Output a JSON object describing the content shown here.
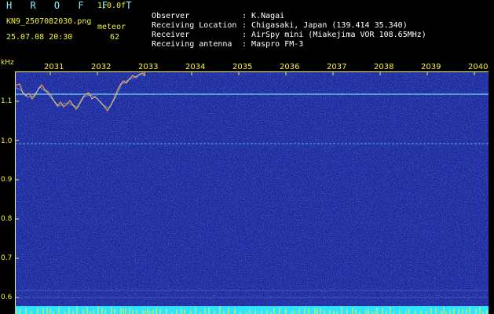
{
  "header": {
    "title": "H R O F F T",
    "version": "1.0.0f",
    "filename": "KN9_2507082030.png",
    "meteor_label": "meteor",
    "datetime": "25.07.08 20:30",
    "meteor_count": "62"
  },
  "meta": [
    {
      "key": "Observer",
      "sep": ":",
      "value": "K.Nagai"
    },
    {
      "key": "Receiving Location",
      "sep": ":",
      "value": "Chigasaki, Japan (139.414 35.340)"
    },
    {
      "key": "Receiver",
      "sep": ":",
      "value": "AirSpy mini (Miakejima VOR 108.65MHz)"
    },
    {
      "key": "Receiving antenna",
      "sep": ":",
      "value": "Maspro FM-3"
    }
  ],
  "axes": {
    "freq_unit": "kHz",
    "time_ticks": [
      "2031",
      "2032",
      "2033",
      "2034",
      "2035",
      "2036",
      "2037",
      "2038",
      "2039",
      "2040"
    ],
    "freq_ticks": [
      "1.1",
      "1.0",
      "0.9",
      "0.8",
      "0.7",
      "0.6"
    ]
  },
  "colors": {
    "background": "#1c2a9e",
    "axis": "#f4f43a",
    "text_cyan": "#7ff7ff",
    "carrier_line": "#7ff7ff"
  }
}
